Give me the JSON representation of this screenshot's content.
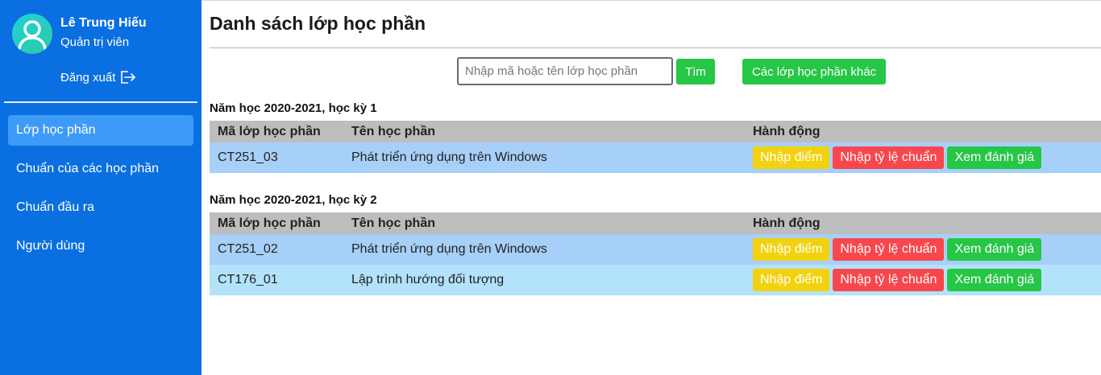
{
  "user": {
    "name": "Lê Trung Hiếu",
    "role": "Quản trị viên",
    "logout_label": "Đăng xuất"
  },
  "sidebar": {
    "items": [
      {
        "label": "Lớp học phần",
        "active": true
      },
      {
        "label": "Chuẩn của các học phần",
        "active": false
      },
      {
        "label": "Chuẩn đầu ra",
        "active": false
      },
      {
        "label": "Người dùng",
        "active": false
      }
    ]
  },
  "main": {
    "title": "Danh sách lớp học phần",
    "search": {
      "placeholder": "Nhập mã hoặc tên lớp học phần",
      "value": "",
      "button_label": "Tìm"
    },
    "other_classes_label": "Các lớp học phần khác",
    "columns": {
      "code": "Mã lớp học phần",
      "name": "Tên học phần",
      "actions": "Hành động"
    },
    "action_labels": {
      "enter_grades": "Nhập điểm",
      "enter_ratio": "Nhập tỷ lệ chuẩn",
      "view_evaluation": "Xem đánh giá"
    },
    "semesters": [
      {
        "title": "Năm học 2020-2021, học kỳ 1",
        "rows": [
          {
            "code": "CT251_03",
            "name": "Phát triển ứng dụng trên Windows"
          }
        ]
      },
      {
        "title": "Năm học 2020-2021, học kỳ 2",
        "rows": [
          {
            "code": "CT251_02",
            "name": "Phát triển ứng dụng trên Windows"
          },
          {
            "code": "CT176_01",
            "name": "Lập trình hướng đối tượng"
          }
        ]
      }
    ]
  },
  "colors": {
    "sidebar_bg": "#0a6fe0",
    "active_item_bg": "#3d9bf7",
    "green": "#26c646",
    "yellow": "#f2d20e",
    "red": "#f7474d",
    "table_header": "#bdbdbd",
    "row_blue": "#a7d0f8",
    "row_light_blue": "#b3e2fb"
  }
}
